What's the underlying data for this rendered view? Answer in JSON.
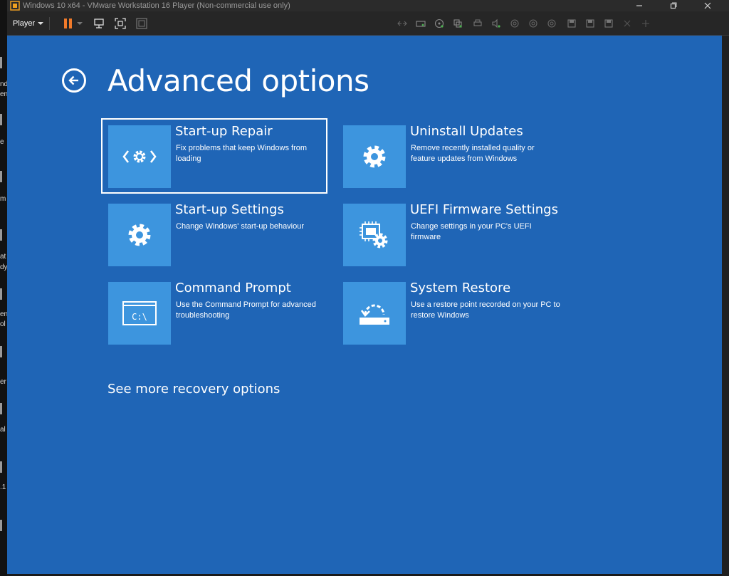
{
  "window": {
    "title": "Windows 10 x64 - VMware Workstation 16 Player (Non-commercial use only)",
    "minimize_icon": "minimize-icon",
    "restore_icon": "restore-icon",
    "close_icon": "close-icon"
  },
  "toolbar": {
    "player_label": "Player",
    "pause_icon": "pause-icon",
    "send_ctrl_alt_del_icon": "ctrl-alt-del-icon",
    "fullscreen_icon": "fullscreen-icon",
    "unity_icon": "unity-icon",
    "device_icons": [
      "network-icon",
      "hard-disk-icon",
      "cd-dvd-icon",
      "usb-icon",
      "printer-icon",
      "sound-icon",
      "device-icon",
      "device-icon",
      "device-icon",
      "floppy-icon",
      "floppy-icon",
      "floppy-icon",
      "device-icon",
      "device-icon"
    ],
    "accent_color": "#f07a2a"
  },
  "desktop_fragments": [
    {
      "text": "nd"
    },
    {
      "text": "en"
    },
    {
      "text": "e"
    },
    {
      "text": "m"
    },
    {
      "text": "at"
    },
    {
      "text": "dy"
    },
    {
      "text": "en"
    },
    {
      "text": "ol"
    },
    {
      "text": "er"
    },
    {
      "text": "al"
    },
    {
      "text": ".1"
    }
  ],
  "guest": {
    "background_color": "#1f65b6",
    "tile_color": "#3d95de",
    "back_icon": "back-arrow-icon",
    "title": "Advanced options",
    "options": [
      {
        "title": "Start-up Repair",
        "description": "Fix problems that keep Windows from loading",
        "icon": "startup-repair-icon",
        "selected": true
      },
      {
        "title": "Uninstall Updates",
        "description": "Remove recently installed quality or feature updates from Windows",
        "icon": "gear-icon",
        "selected": false
      },
      {
        "title": "Start-up Settings",
        "description": "Change Windows' start-up behaviour",
        "icon": "gear-icon",
        "selected": false
      },
      {
        "title": "UEFI Firmware Settings",
        "description": "Change settings in your PC's UEFI firmware",
        "icon": "firmware-chip-icon",
        "selected": false
      },
      {
        "title": "Command Prompt",
        "description": "Use the Command Prompt for advanced troubleshooting",
        "icon": "command-prompt-icon",
        "icon_text": "C:\\",
        "selected": false
      },
      {
        "title": "System Restore",
        "description": "Use a restore point recorded on your PC to restore Windows",
        "icon": "system-restore-icon",
        "selected": false
      }
    ],
    "more_options": "See more recovery options"
  }
}
